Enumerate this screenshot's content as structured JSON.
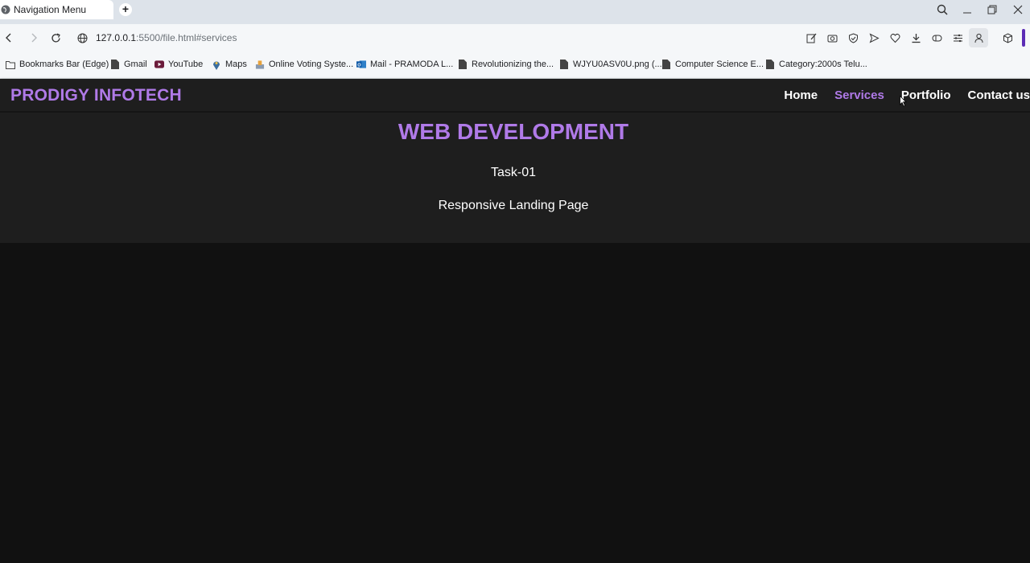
{
  "browser": {
    "tab_title": "Navigation Menu",
    "new_tab_label": "+",
    "url_host": "127.0.0.1",
    "url_rest": ":5500/file.html#services",
    "bookmarks": [
      {
        "label": "Bookmarks Bar (Edge)",
        "icon": "folder-icon"
      },
      {
        "label": "Gmail",
        "icon": "page-icon"
      },
      {
        "label": "YouTube",
        "icon": "youtube-icon"
      },
      {
        "label": "Maps",
        "icon": "maps-pin-icon"
      },
      {
        "label": "Online Voting Syste...",
        "icon": "voting-icon"
      },
      {
        "label": "Mail - PRAMODA L...",
        "icon": "outlook-icon"
      },
      {
        "label": "Revolutionizing the...",
        "icon": "page-icon"
      },
      {
        "label": "WJYU0ASV0U.png (...",
        "icon": "page-icon"
      },
      {
        "label": "Computer Science E...",
        "icon": "page-icon"
      },
      {
        "label": "Category:2000s Telu...",
        "icon": "page-icon"
      }
    ]
  },
  "site": {
    "logo": "PRODIGY INFOTECH",
    "nav": [
      "Home",
      "Services",
      "Portfolio",
      "Contact us"
    ],
    "active_nav": "Services",
    "hero": {
      "title": "WEB DEVELOPMENT",
      "line1": "Task-01",
      "line2": "Responsive Landing Page"
    }
  },
  "colors": {
    "accent": "#b07ae8",
    "nav_bg": "#1e1e1e",
    "page_bg": "#111111"
  }
}
